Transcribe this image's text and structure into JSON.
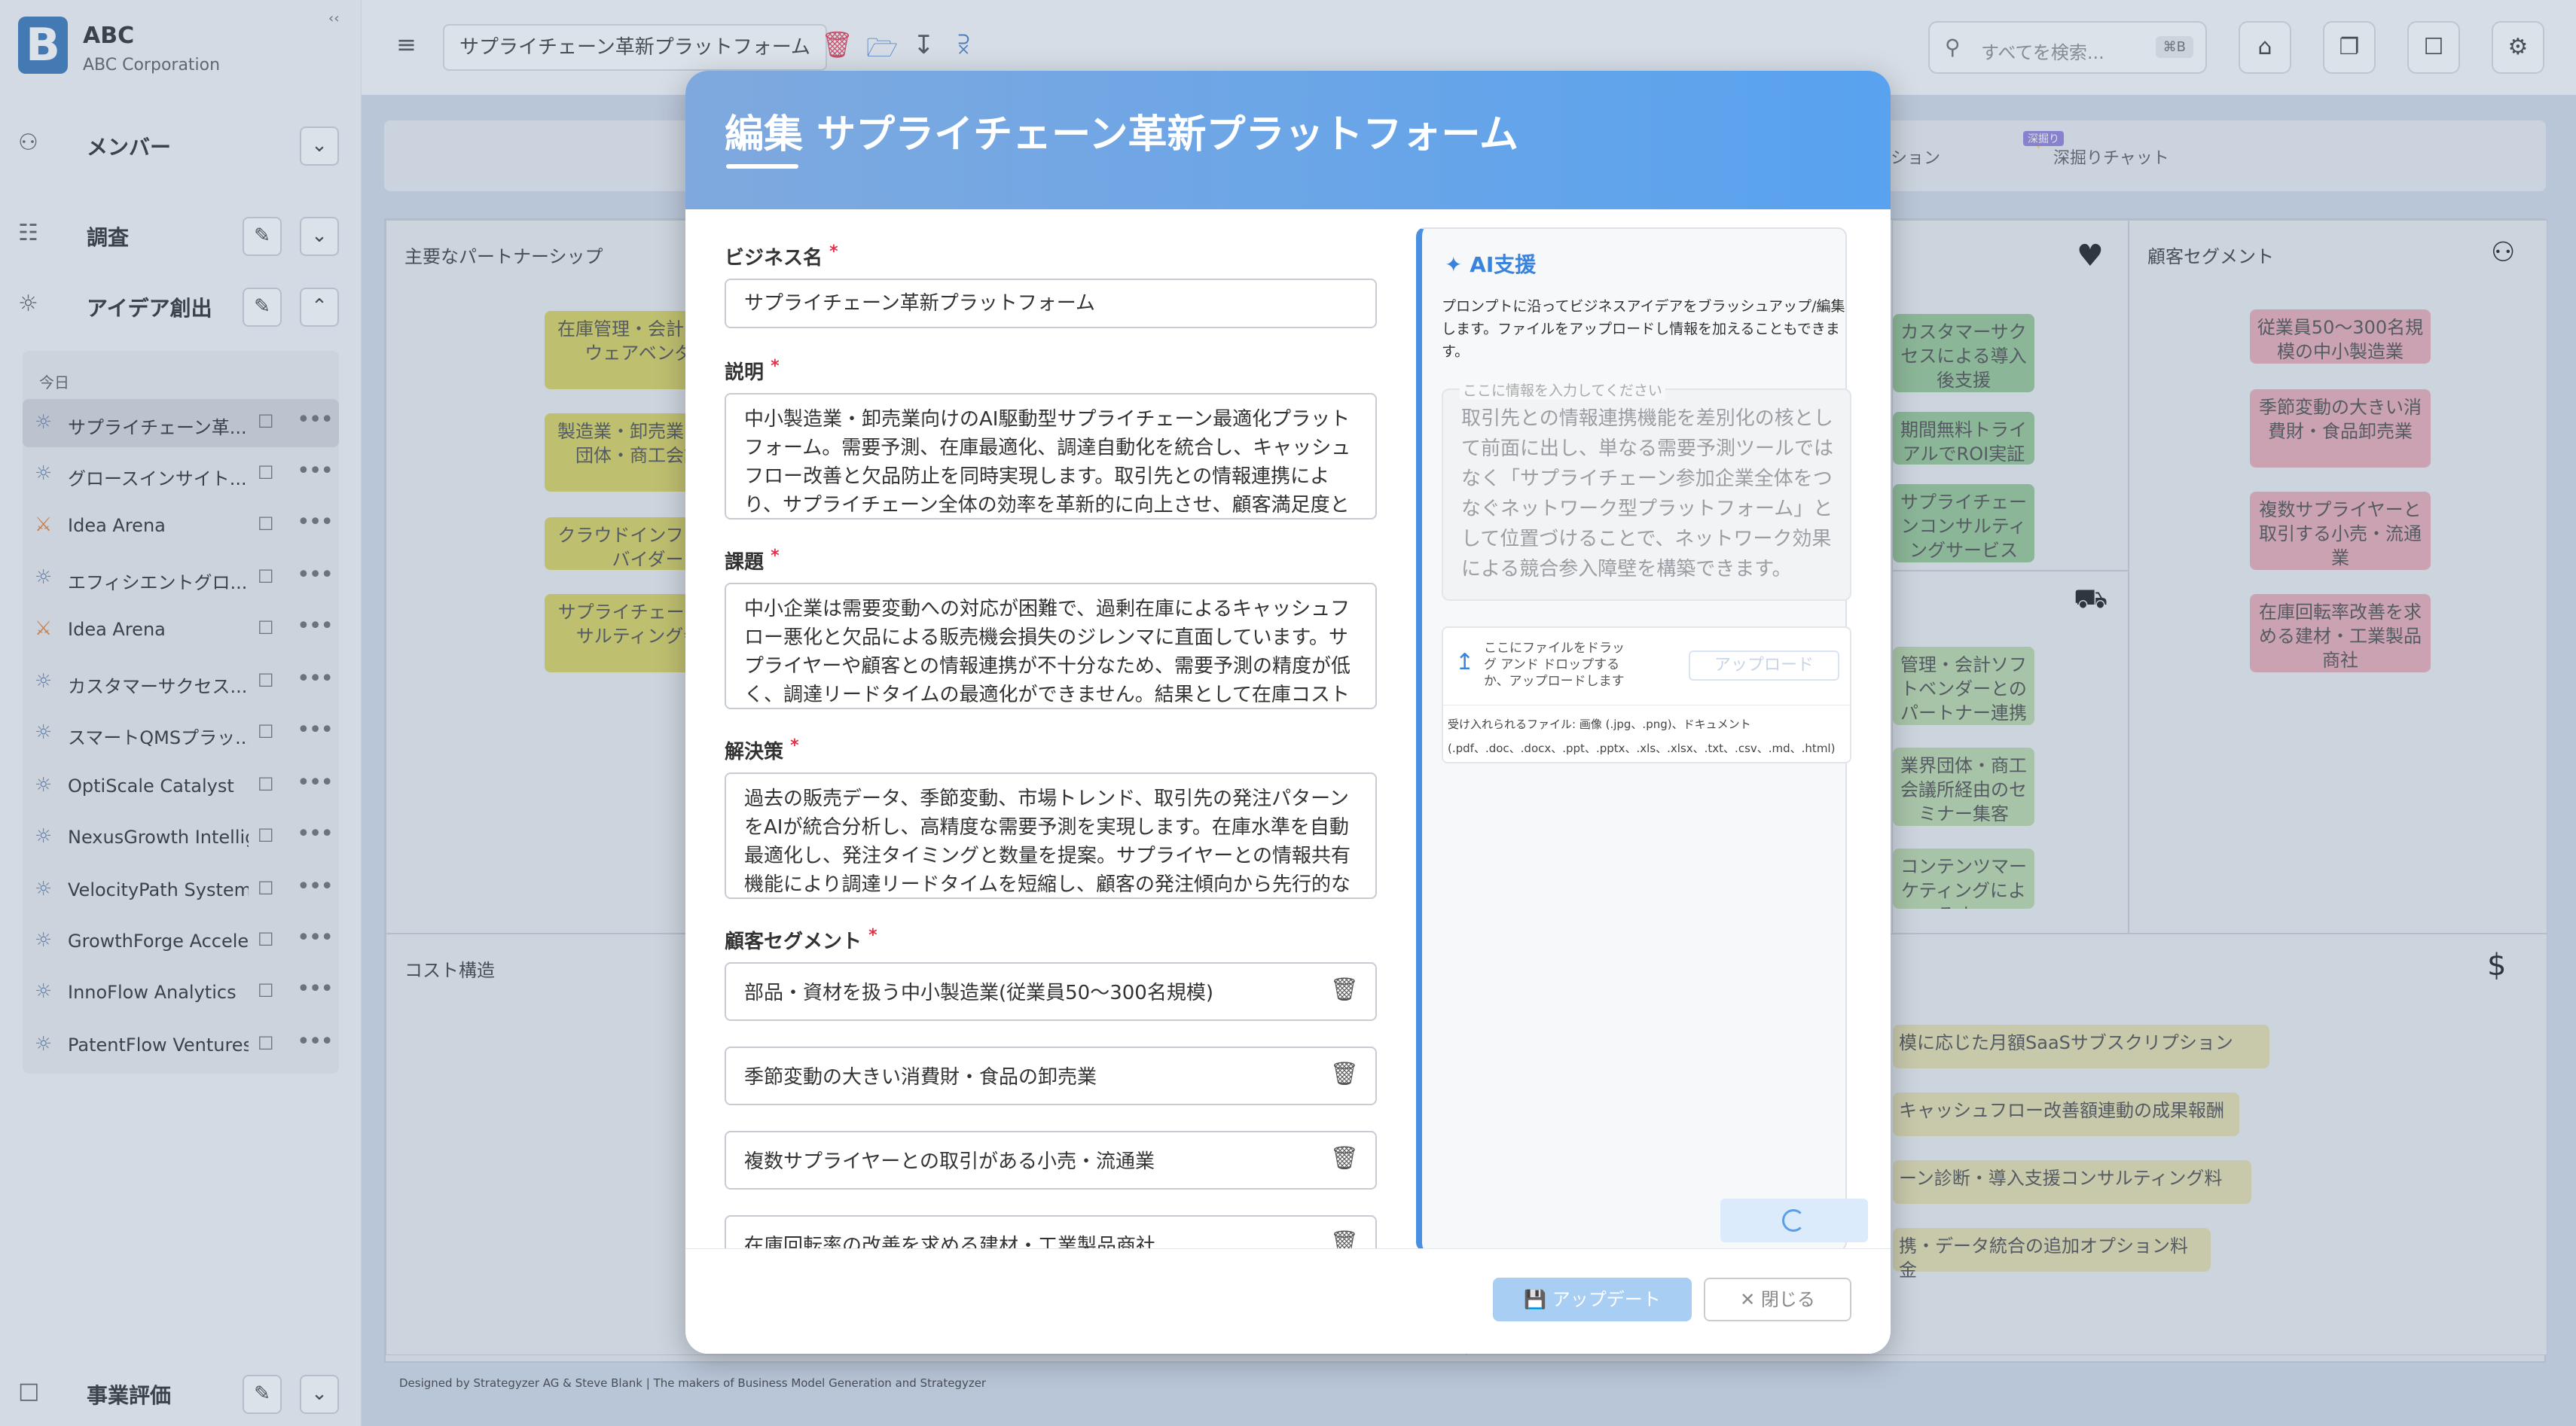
{
  "app": {
    "logo_letter": "B",
    "name": "ABC",
    "company": "ABC Corporation",
    "collapse": "‹‹"
  },
  "sidebar": {
    "sections": [
      {
        "label": "メンバー"
      },
      {
        "label": "調査"
      },
      {
        "label": "アイデア創出"
      },
      {
        "label": "事業評価"
      }
    ],
    "list_group": "今日",
    "items": [
      {
        "label": "サプライチェーン革..."
      },
      {
        "label": "グロースインサイト..."
      },
      {
        "label": "Idea Arena"
      },
      {
        "label": "エフィシエントグロ..."
      },
      {
        "label": "Idea Arena"
      },
      {
        "label": "カスタマーサクセス..."
      },
      {
        "label": "スマートQMSプラッ..."
      },
      {
        "label": "OptiScale Catalyst"
      },
      {
        "label": "NexusGrowth Intellig..."
      },
      {
        "label": "VelocityPath Systems"
      },
      {
        "label": "GrowthForge Accele..."
      },
      {
        "label": "InnoFlow Analytics"
      },
      {
        "label": "PatentFlow Ventures"
      }
    ]
  },
  "topbar": {
    "doc_title": "サプライチェーン革新プラットフォーム",
    "search_placeholder": "すべてを検索...",
    "search_kbd": "⌘B"
  },
  "tabs": {
    "partial": "ション",
    "deep": "深掘りチャット",
    "deep_badge": "深掘り"
  },
  "canvas": {
    "partners": {
      "title": "主要なパートナーシップ",
      "notes": [
        "在庫管理・会計ソフトウェアベンダー",
        "製造業・卸売業の業界団体・商工会議所",
        "クラウドインフラプロバイダー",
        "サプライチェーンコンサルティング会社"
      ]
    },
    "relations": {
      "notes": [
        "カスタマーサクセスによる導入後支援",
        "期間無料トライアルでROI実証",
        "サプライチェーンコンサルティングサービス"
      ]
    },
    "channels": {
      "notes": [
        "管理・会計ソフトベンダーとのパートナー連携",
        "業界団体・商工会議所経由のセミナー集客",
        "コンテンツマーケティングによるオ..."
      ]
    },
    "segments": {
      "title": "顧客セグメント",
      "notes": [
        "従業員50〜300名規模の中小製造業",
        "季節変動の大きい消費財・食品卸売業",
        "複数サプライヤーと取引する小売・流通業",
        "在庫回転率改善を求める建材・工業製品商社"
      ]
    },
    "cost": {
      "title": "コスト構造"
    },
    "revenue": {
      "notes": [
        "模に応じた月額SaaSサブスクリプション",
        "キャッシュフロー改善額連動の成果報酬",
        "ーン診断・導入支援コンサルティング料",
        "携・データ統合の追加オプション料金"
      ]
    },
    "footer": "Designed by Strategyzer AG & Steve Blank | The makers of Business Model Generation and Strategyzer"
  },
  "modal": {
    "title": "編集 サプライチェーン革新プラットフォーム",
    "req": "*",
    "fields": {
      "name_label": "ビジネス名",
      "name_value": "サプライチェーン革新プラットフォーム",
      "desc_label": "説明",
      "desc_value": "中小製造業・卸売業向けのAI駆動型サプライチェーン最適化プラットフォーム。需要予測、在庫最適化、調達自動化を統合し、キャッシュフロー改善と欠品防止を同時実現します。取引先との情報連携により、サプライチェーン全体の効率を革新的に向上させ、顧客満足度と",
      "issue_label": "課題",
      "issue_value": "中小企業は需要変動への対応が困難で、過剰在庫によるキャッシュフロー悪化と欠品による販売機会損失のジレンマに直面しています。サプライヤーや顧客との情報連携が不十分なため、需要予測の精度が低く、調達リードタイムの最適化ができません。結果として在庫コスト",
      "solution_label": "解決策",
      "solution_value": "過去の販売データ、季節変動、市場トレンド、取引先の発注パターンをAIが統合分析し、高精度な需要予測を実現します。在庫水準を自動最適化し、発注タイミングと数量を提案。サプライヤーとの情報共有機能により調達リードタイムを短縮し、顧客の発注傾向から先行的な",
      "segment_label": "顧客セグメント",
      "segments": [
        "部品・資材を扱う中小製造業(従業員50〜300名規模)",
        "季節変動の大きい消費財・食品の卸売業",
        "複数サプライヤーとの取引がある小売・流通業",
        "在庫回転率の改善を求める建材・工業製品商社"
      ]
    },
    "ai": {
      "title": "AI支援",
      "description": "プロンプトに沿ってビジネスアイデアをブラッシュアップ/編集します。ファイルをアップロードし情報を加えることもできます。",
      "input_label": "ここに情報を入力してください",
      "input_placeholder": "取引先との情報連携機能を差別化の核として前面に出し、単なる需要予測ツールではなく「サプライチェーン参加企業全体をつなぐネットワーク型プラットフォーム」として位置づけることで、ネットワーク効果による競合参入障壁を構築できます。",
      "drop_text": "ここにファイルをドラッグ アンド ドロップするか、アップロードします",
      "upload_button": "アップロード",
      "accepted": "受け入れられるファイル: 画像 (.jpg、.png)、ドキュメント (.pdf、.doc、.docx、.ppt、.pptx、.xls、.xlsx、.txt、.csv、.md、.html)"
    },
    "update_button": "アップデート",
    "close_button": "閉じる"
  }
}
